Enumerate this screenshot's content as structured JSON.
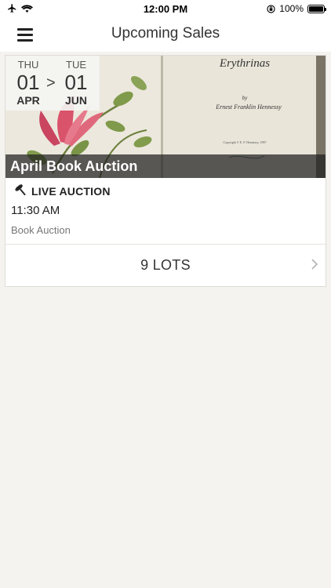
{
  "status_bar": {
    "time": "12:00 PM",
    "battery_text": "100%",
    "battery_level": 1.0,
    "icons": [
      "airplane-icon",
      "wifi-icon",
      "orientation-lock-icon",
      "battery-icon"
    ]
  },
  "nav": {
    "title": "Upcoming Sales",
    "menu_icon": "hamburger-menu-icon"
  },
  "sale": {
    "start": {
      "dow": "THU",
      "day": "01",
      "month": "APR"
    },
    "separator": ">",
    "end": {
      "dow": "TUE",
      "day": "01",
      "month": "JUN"
    },
    "title": "April Book Auction",
    "auction_type": "LIVE AUCTION",
    "auction_icon": "gavel-icon",
    "time": "11:30 AM",
    "category": "Book Auction",
    "lots_label": "9 LOTS",
    "lots_icon": "chevron-right-icon",
    "image_text": {
      "title": "Erythrinas",
      "by": "by",
      "author": "Ernest Franklin Hennessy",
      "copyright": "Copyright © E. F. Hennessy, 1987"
    }
  },
  "colors": {
    "background": "#f4f3ef",
    "card": "#ffffff",
    "title_bar": "#1e1e1e",
    "flower": "#d9536b",
    "leaf": "#7f9a4a"
  }
}
